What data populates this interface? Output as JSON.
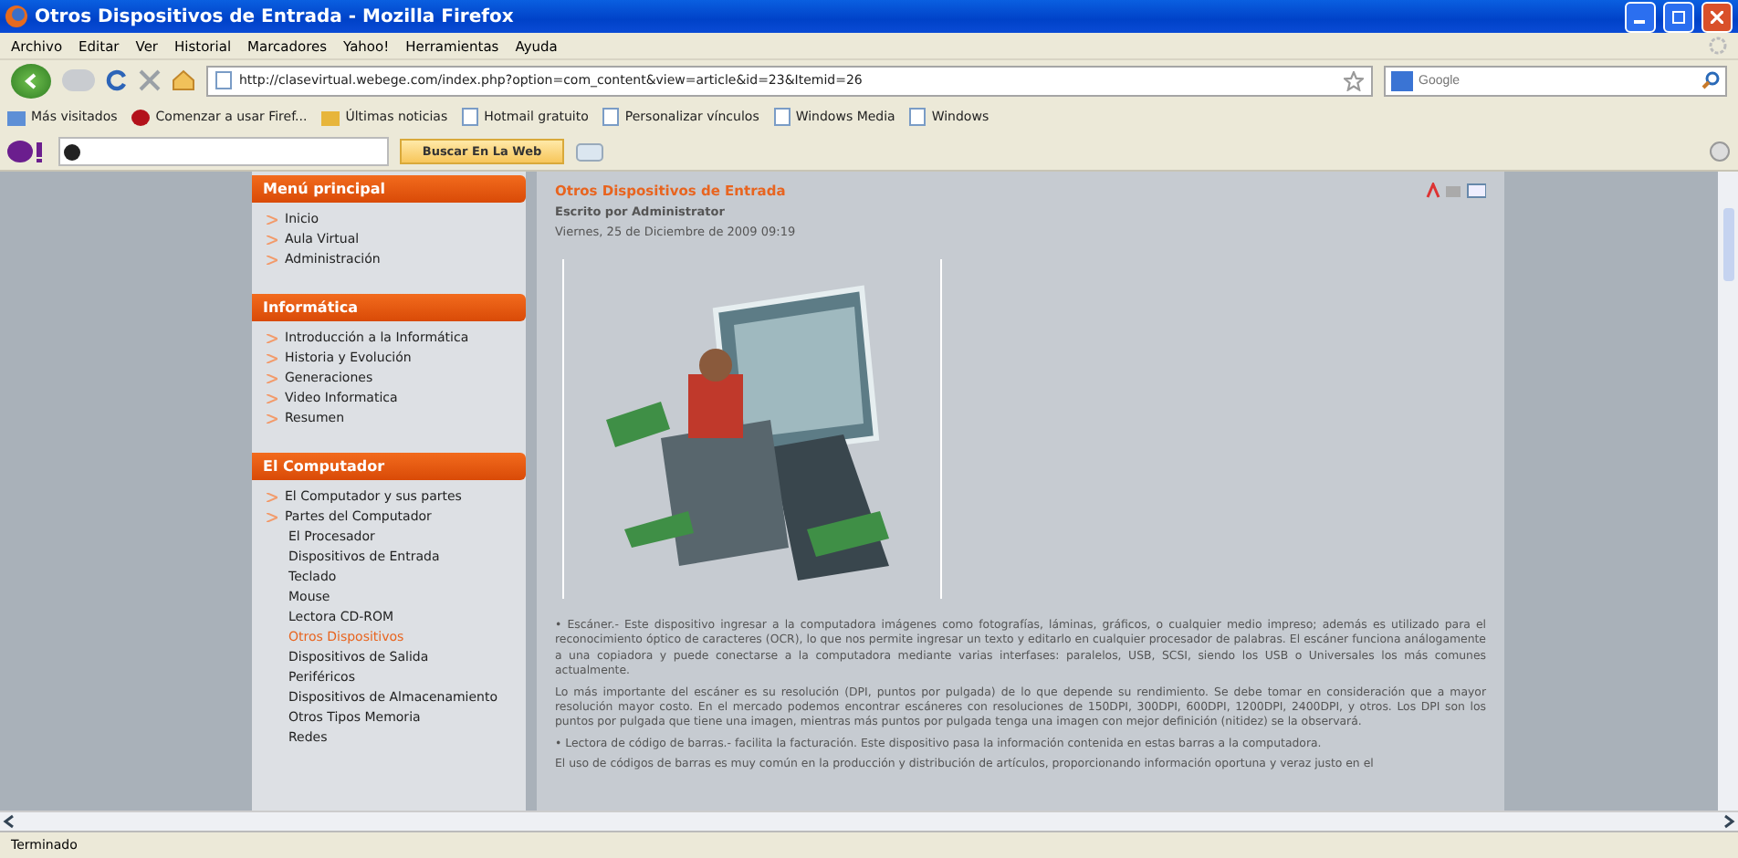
{
  "window": {
    "title": "Otros Dispositivos de Entrada - Mozilla Firefox"
  },
  "menu": [
    "Archivo",
    "Editar",
    "Ver",
    "Historial",
    "Marcadores",
    "Yahoo!",
    "Herramientas",
    "Ayuda"
  ],
  "navigation": {
    "url": "http://clasevirtual.webege.com/index.php?option=com_content&view=article&id=23&Itemid=26",
    "search_placeholder": "Google"
  },
  "bookmarks": [
    {
      "label": "Más visitados",
      "kind": "folder"
    },
    {
      "label": "Comenzar a usar Firef...",
      "kind": "firefox"
    },
    {
      "label": "Últimas noticias",
      "kind": "feed"
    },
    {
      "label": "Hotmail gratuito",
      "kind": "page"
    },
    {
      "label": "Personalizar vínculos",
      "kind": "page"
    },
    {
      "label": "Windows Media",
      "kind": "page"
    },
    {
      "label": "Windows",
      "kind": "page"
    }
  ],
  "yahoo_toolbar": {
    "search_button": "Buscar En La Web"
  },
  "sidebar": [
    {
      "title": "Menú principal",
      "items": [
        {
          "label": "Inicio",
          "selected": false
        },
        {
          "label": "Aula Virtual",
          "selected": false
        },
        {
          "label": "Administración",
          "selected": false
        }
      ]
    },
    {
      "title": "Informática",
      "items": [
        {
          "label": "Introducción a la Informática",
          "selected": false
        },
        {
          "label": "Historia y Evolución",
          "selected": false
        },
        {
          "label": "Generaciones",
          "selected": false
        },
        {
          "label": "Video Informatica",
          "selected": false
        },
        {
          "label": "Resumen",
          "selected": false
        }
      ]
    },
    {
      "title": "El Computador",
      "items": [
        {
          "label": "El Computador y sus partes",
          "selected": false
        },
        {
          "label": "Partes del Computador",
          "selected": false,
          "children": [
            {
              "label": "El Procesador",
              "selected": false
            },
            {
              "label": "Dispositivos de Entrada",
              "selected": false
            },
            {
              "label": "Teclado",
              "selected": false
            },
            {
              "label": "Mouse",
              "selected": false
            },
            {
              "label": "Lectora CD-ROM",
              "selected": false
            },
            {
              "label": "Otros Dispositivos",
              "selected": true
            },
            {
              "label": "Dispositivos de Salida",
              "selected": false
            },
            {
              "label": "Periféricos",
              "selected": false
            },
            {
              "label": "Dispositivos de Almacenamiento",
              "selected": false
            },
            {
              "label": "Otros Tipos Memoria",
              "selected": false
            },
            {
              "label": "Redes",
              "selected": false
            }
          ]
        }
      ]
    }
  ],
  "article": {
    "title": "Otros Dispositivos de Entrada",
    "author": "Escrito por Administrator",
    "date": "Viernes, 25 de Diciembre de 2009 09:19",
    "paragraphs": [
      "• Escáner.- Este dispositivo ingresar a la computadora imágenes como fotografías, láminas, gráficos, o cualquier medio impreso; además es utilizado para el reconocimiento óptico de caracteres (OCR), lo que nos permite ingresar un texto y editarlo en cualquier procesador de palabras. El escáner funciona análogamente a una copiadora y puede conectarse a la computadora mediante varias interfases: paralelos, USB, SCSI, siendo los USB o Universales los más comunes actualmente.",
      "Lo más importante del escáner es su resolución (DPI, puntos por pulgada) de lo que depende su rendimiento. Se debe tomar en consideración que a mayor resolución mayor costo. En el mercado podemos encontrar escáneres con resoluciones de 150DPI, 300DPI, 600DPI, 1200DPI, 2400DPI, y otros. Los DPI son los puntos por pulgada que tiene una imagen, mientras más puntos por pulgada tenga una imagen con mejor definición (nitidez) se la observará.",
      "• Lectora de código de barras.- facilita la facturación. Este dispositivo pasa la información contenida en estas barras a la computadora.",
      "El uso de códigos de barras es muy común en la producción y distribución de artículos, proporcionando información oportuna y veraz justo en el"
    ]
  },
  "status_bar": {
    "text": "Terminado"
  }
}
